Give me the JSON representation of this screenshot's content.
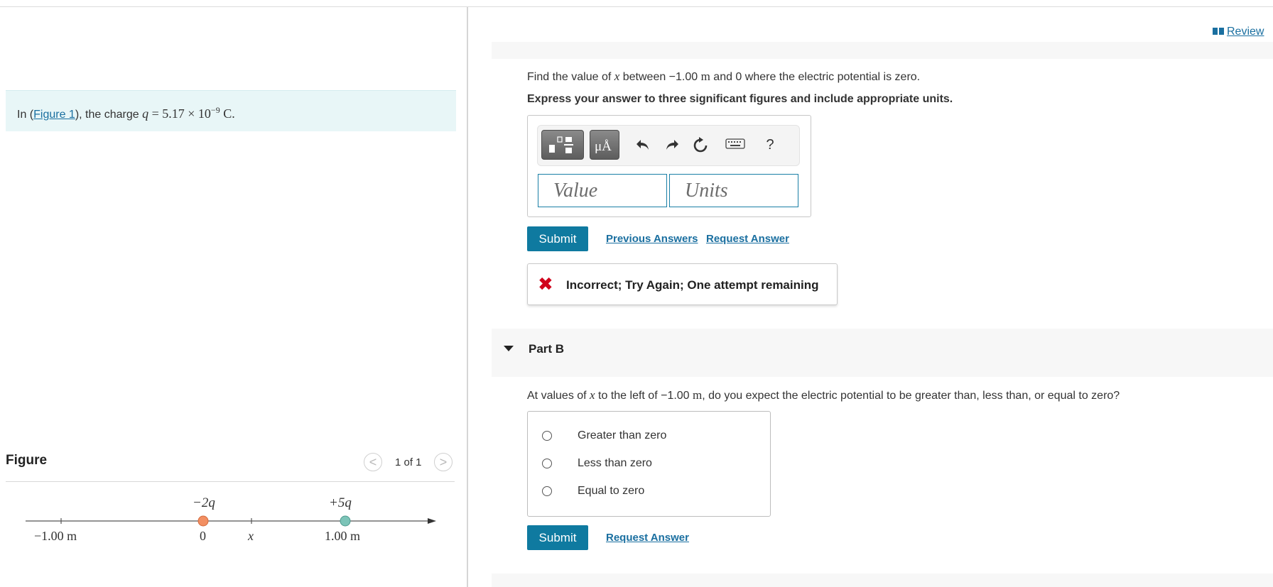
{
  "left": {
    "intro": {
      "prefix": "In (",
      "figure_link": "Figure 1",
      "suffix": "), the charge ",
      "var": "q",
      "equals": " = 5.17 × 10",
      "exponent": "−9",
      "unit": " C."
    },
    "figure": {
      "label": "Figure",
      "pager_text": "1 of 1",
      "prev_glyph": "<",
      "next_glyph": ">",
      "diagram": {
        "charge_left_label": "−2q",
        "charge_right_label": "+5q",
        "tick_left_label": "−1.00 m",
        "tick_zero_label": "0",
        "tick_x_label": "x",
        "tick_right_label": "1.00 m",
        "charge_left_color": "#f28f62",
        "charge_right_color": "#7cc4b8"
      }
    }
  },
  "right": {
    "review": {
      "label": "Review",
      "icon": "book-icon"
    },
    "partA": {
      "question_prefix": "Find the value of ",
      "question_var": "x",
      "question_mid": " between −1.00 ",
      "question_unit": "m",
      "question_suffix": " and 0 where the electric potential is zero.",
      "instruction": "Express your answer to three significant figures and include appropriate units.",
      "toolbar": {
        "units_glyph": "μÅ",
        "help_glyph": "?"
      },
      "value_placeholder": "Value",
      "units_placeholder": "Units",
      "submit_label": "Submit",
      "previous_answers_label": "Previous Answers",
      "request_answer_label": "Request Answer",
      "feedback_glyph": "✖",
      "feedback_text": "Incorrect; Try Again; One attempt remaining"
    },
    "partB": {
      "title": "Part B",
      "question_prefix": "At values of ",
      "question_var": "x",
      "question_mid": " to the left of −1.00 ",
      "question_unit": "m",
      "question_suffix": ", do you expect the electric potential to be greater than, less than, or equal to zero?",
      "options": [
        "Greater than zero",
        "Less than zero",
        "Equal to zero"
      ],
      "submit_label": "Submit",
      "request_answer_label": "Request Answer"
    }
  },
  "colors": {
    "accent": "#0f7aa0",
    "link": "#1a6fa0",
    "error": "#d0021b",
    "intro_bg": "#e8f6f7"
  }
}
